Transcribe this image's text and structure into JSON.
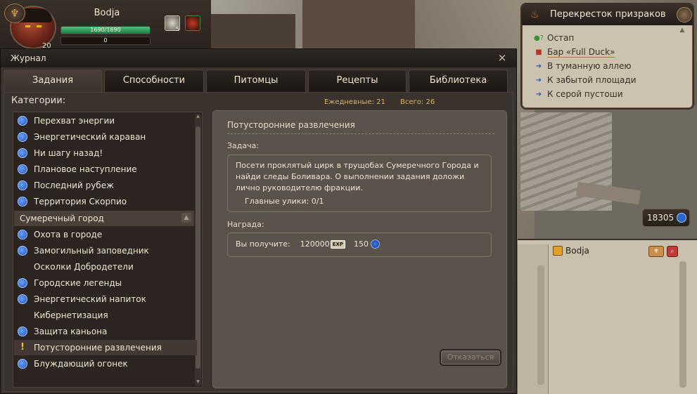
{
  "player": {
    "name": "Bodja",
    "hp_text": "1690/1690",
    "hp_fraction": 1.0,
    "mp_text": "0",
    "level": "20",
    "buff_count": "5"
  },
  "location": {
    "title": "Перекресток призраков",
    "items": [
      {
        "label": "Остап",
        "icon": "npc-icon",
        "link": false
      },
      {
        "label": "Бар «Full Duck»",
        "icon": "bar-icon",
        "link": true
      },
      {
        "label": "В туманную аллею",
        "icon": "arrow-icon",
        "link": false
      },
      {
        "label": "К забытой площади",
        "icon": "arrow-icon",
        "link": false
      },
      {
        "label": "К серой пустоши",
        "icon": "arrow-icon",
        "link": false
      }
    ]
  },
  "money": "18305",
  "chat": {
    "user": "Bodja"
  },
  "journal": {
    "title": "Журнал",
    "close": "×",
    "tabs": [
      "Задания",
      "Способности",
      "Питомцы",
      "Рецепты",
      "Библиотека"
    ],
    "categories_label": "Категории:",
    "daily": "Ежедневные: 21",
    "total": "Всего: 26",
    "quests_a": [
      "Перехват энергии",
      "Энергетический караван",
      "Ни шагу назад!",
      "Плановое наступление",
      "Последний рубеж",
      "Территория Скорпио"
    ],
    "category_b": "Сумеречный город",
    "quests_b": [
      {
        "label": "Охота в городе",
        "icon": "quest"
      },
      {
        "label": "Замогильный заповедник",
        "icon": "quest"
      },
      {
        "label": "Осколки Добродетели",
        "icon": "none"
      },
      {
        "label": "Городские легенды",
        "icon": "quest"
      },
      {
        "label": "Энергетический напиток",
        "icon": "quest"
      },
      {
        "label": "Кибернетизация",
        "icon": "none"
      },
      {
        "label": "Защита каньона",
        "icon": "quest"
      },
      {
        "label": "Потусторонние развлечения",
        "icon": "warn"
      },
      {
        "label": "Блуждающий огонек",
        "icon": "quest"
      }
    ],
    "detail": {
      "title": "Потусторонние развлечения",
      "task_label": "Задача:",
      "task_text": "Посети проклятый цирк в трущобах Сумеречного Города и найди следы Боливара. О выполнении задания доложи лично руководителю фракции.",
      "clues": "Главные улики: 0/1",
      "reward_label": "Награда:",
      "reward_prefix": "Вы получите:",
      "reward_exp": "120000",
      "exp_tag": "EXP",
      "reward_gems": "150",
      "decline": "Отказаться"
    }
  }
}
